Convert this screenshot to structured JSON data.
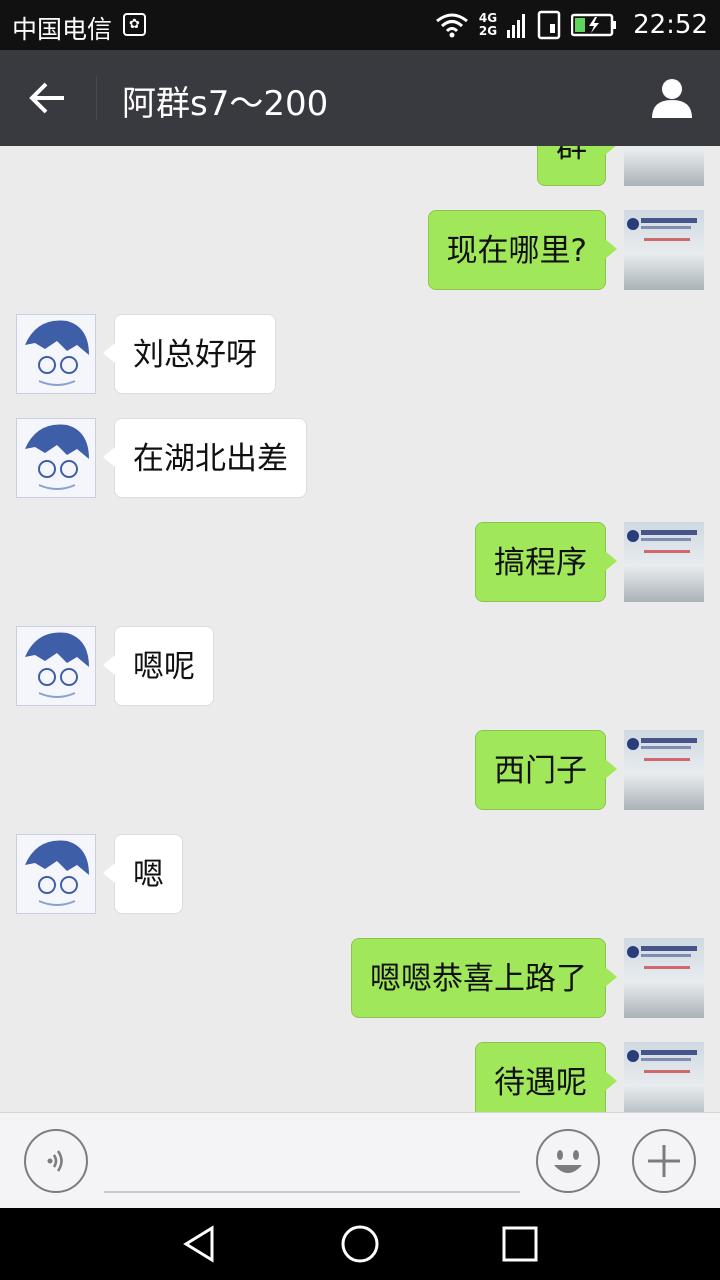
{
  "status_bar": {
    "carrier": "中国电信",
    "carrier_icon": "baidu-paw-icon",
    "network_4g": "4G",
    "network_2g": "2G",
    "time": "22:52",
    "icons": [
      "wifi-icon",
      "signal-icon",
      "sim-icon",
      "battery-charging-icon"
    ]
  },
  "header": {
    "title": "阿群s7～200",
    "back_icon": "back-arrow-icon",
    "profile_icon": "person-icon"
  },
  "messages": [
    {
      "side": "me",
      "text": "群"
    },
    {
      "side": "me",
      "text": "现在哪里?"
    },
    {
      "side": "other",
      "text": "刘总好呀"
    },
    {
      "side": "other",
      "text": "在湖北出差"
    },
    {
      "side": "me",
      "text": "搞程序"
    },
    {
      "side": "other",
      "text": "嗯呢"
    },
    {
      "side": "me",
      "text": "西门子"
    },
    {
      "side": "other",
      "text": "嗯"
    },
    {
      "side": "me",
      "text": "嗯嗯恭喜上路了"
    },
    {
      "side": "me",
      "text": "待遇呢"
    }
  ],
  "input_bar": {
    "voice_icon": "voice-icon",
    "text_value": "",
    "emoji_icon": "emoji-icon",
    "plus_icon": "plus-icon"
  },
  "nav_bar": {
    "icons": [
      "nav-back-icon",
      "nav-home-icon",
      "nav-recents-icon"
    ]
  },
  "colors": {
    "title_bar": "#393a3f",
    "chat_bg": "#ebebeb",
    "my_bubble": "#a0e75a",
    "other_bubble": "#ffffff"
  }
}
